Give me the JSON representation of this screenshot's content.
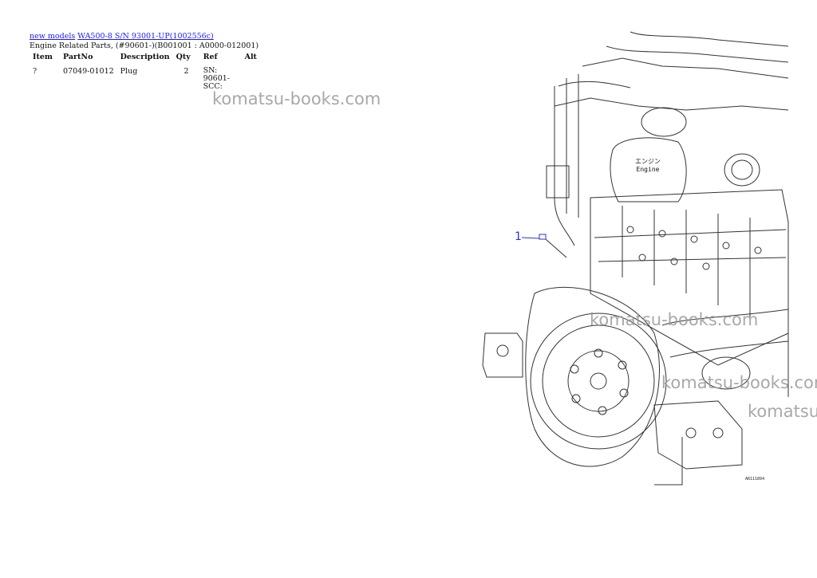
{
  "breadcrumb": {
    "link1": "new models",
    "link2": "WA500-8 S/N 93001-UP(1002556c)"
  },
  "subtitle": "Engine Related Parts, (#90601-)(B001001 : A0000-012001)",
  "table": {
    "headers": [
      "Item",
      "PartNo",
      "Description",
      "Qty",
      "Ref",
      "Alt"
    ],
    "rows": [
      {
        "item": "?",
        "partno": "07049-01012",
        "description": "Plug",
        "qty": "2",
        "ref": "SN: 90601-SCC:",
        "alt": ""
      }
    ]
  },
  "watermark": "komatsu-books.com",
  "diagram": {
    "callout": "1",
    "engine_label_line1": "エンジン",
    "engine_label_line2": "Engine",
    "figure_code": "AR111894"
  }
}
